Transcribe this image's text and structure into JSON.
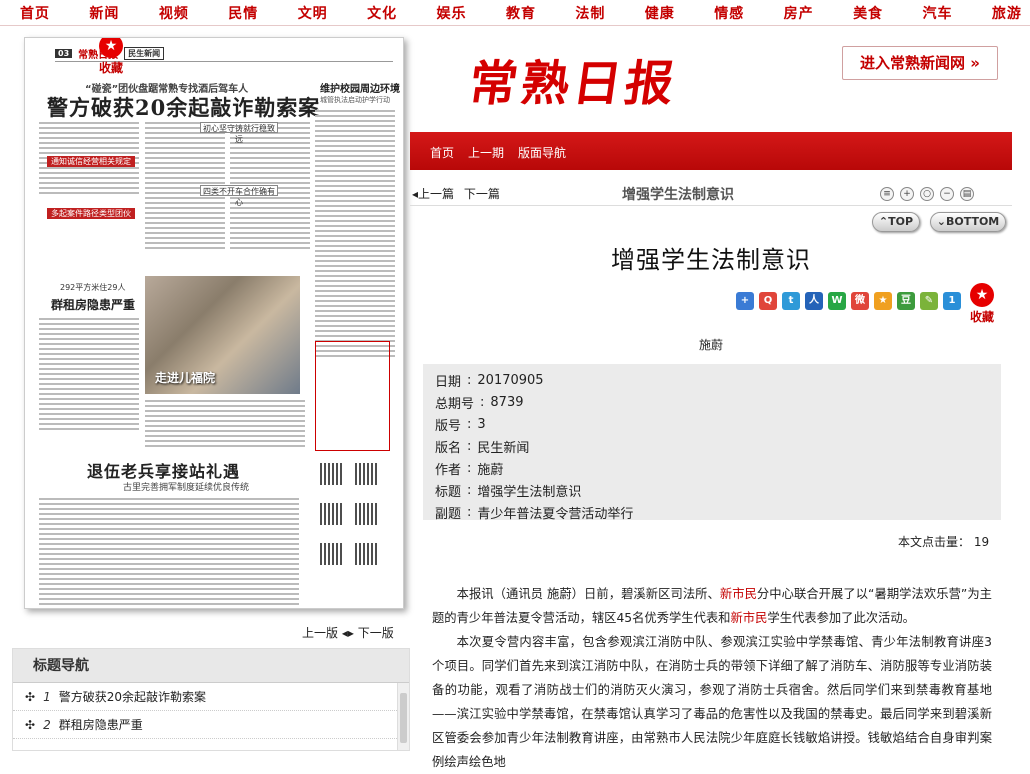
{
  "top_nav": [
    "首页",
    "新闻",
    "视频",
    "民情",
    "文明",
    "文化",
    "娱乐",
    "教育",
    "法制",
    "健康",
    "情感",
    "房产",
    "美食",
    "汽车",
    "旅游"
  ],
  "favorite_label": "收藏",
  "paper": {
    "page_no": "03",
    "masthead": "常熟日报",
    "section": "民生新闻",
    "kicker": "“碰瓷”团伙盘踞常熟专找酒后驾车人",
    "headline": "警方破获20余起敲诈勒索案",
    "right_col_title": "维护校园周边环境",
    "right_col_sub": "城管执法启动护学行动",
    "side_title": "群租房隐患严重",
    "side_kicker": "292平方米住29人",
    "photo_caption": "走进儿福院",
    "headline2": "退伍老兵享接站礼遇",
    "sub2": "古里完善拥军制度延续优良传统",
    "bar1": "通知诚信经营相关规定",
    "bar2": "多起案件路径类型团伙",
    "bar3": "初心坚守铸就行稳致远",
    "bar4": "四类不开车合作确有心"
  },
  "page_nav": {
    "prev": "上一版",
    "next": "下一版"
  },
  "topics": {
    "title": "标题导航",
    "items": [
      {
        "num": "1",
        "title": "警方破获20余起敲诈勒索案"
      },
      {
        "num": "2",
        "title": "群租房隐患严重"
      }
    ]
  },
  "brand": "常熟日报",
  "enter_button": "进入常熟新闻网 »",
  "red_bar_links": [
    "首页",
    "上一期",
    "版面导航"
  ],
  "toolbar": {
    "prev": "上一篇",
    "next": "下一篇",
    "crumb": "增强学生法制意识"
  },
  "top_label": "TOP",
  "bottom_label": "BOTTOM",
  "article_title": "增强学生法制意识",
  "author": "施蔚",
  "meta": [
    {
      "k": "日期",
      "v": "20170905"
    },
    {
      "k": "总期号",
      "v": "8739"
    },
    {
      "k": "版号",
      "v": "3"
    },
    {
      "k": "版名",
      "v": "民生新闻"
    },
    {
      "k": "作者",
      "v": "施蔚"
    },
    {
      "k": "标题",
      "v": "增强学生法制意识"
    },
    {
      "k": "副题",
      "v": "青少年普法夏令营活动举行"
    }
  ],
  "clicks_label": "本文点击量：",
  "clicks": "19",
  "article": {
    "p1a": "本报讯（通讯员 施蔚）日前，碧溪新区司法所、",
    "p1b": "新市民",
    "p1c": "分中心联合开展了以“暑期学法欢乐营”为主题的青少年普法夏令营活动，辖区45名优秀学生代表和",
    "p1d": "新市民",
    "p1e": "学生代表参加了此次活动。",
    "p2": "本次夏令营内容丰富，包含参观滨江消防中队、参观滨江实验中学禁毒馆、青少年法制教育讲座3个项目。同学们首先来到滨江消防中队，在消防士兵的带领下详细了解了消防车、消防服等专业消防装备的功能，观看了消防战士们的消防灭火演习，参观了消防士兵宿舍。然后同学们来到禁毒教育基地——滨江实验中学禁毒馆，在禁毒馆认真学习了毒品的危害性以及我国的禁毒史。最后同学来到碧溪新区管委会参加青少年法制教育讲座，由常熟市人民法院少年庭庭长钱敏焰讲授。钱敏焰结合自身审判案例绘声绘色地"
  }
}
